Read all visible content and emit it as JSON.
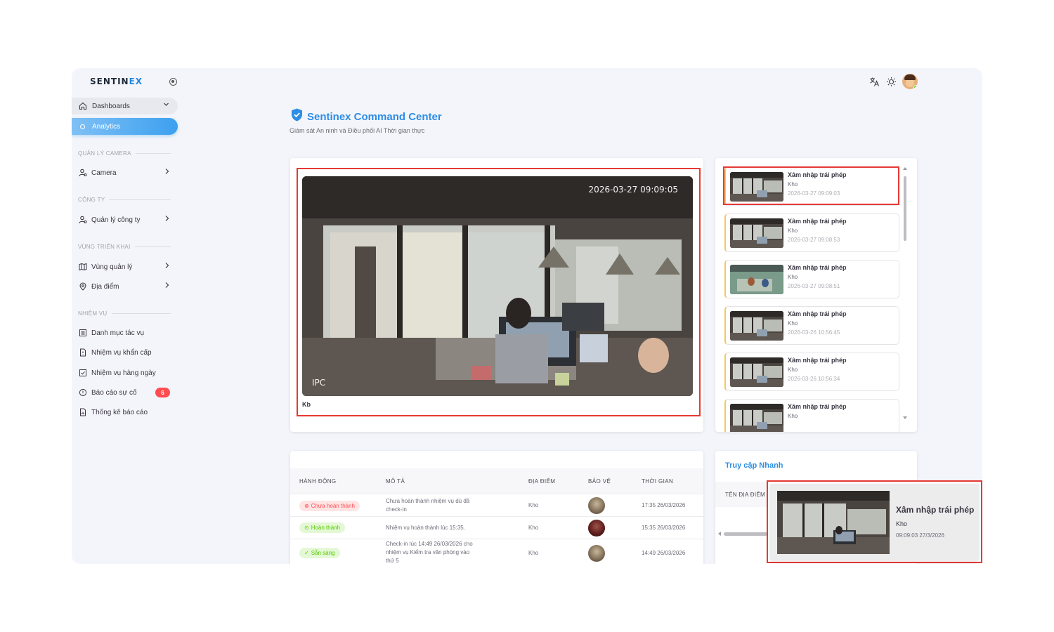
{
  "brand": {
    "name_main": "SENTIN",
    "name_accent": "EX"
  },
  "sidebar": {
    "dashboards_label": "Dashboards",
    "analytics_label": "Analytics",
    "sections": [
      {
        "title": "QUẢN LÝ CAMERA",
        "items": [
          {
            "label": "Camera",
            "icon": "camera-user-icon"
          }
        ]
      },
      {
        "title": "CÔNG TY",
        "items": [
          {
            "label": "Quản lý công ty",
            "icon": "user-settings-icon"
          }
        ]
      },
      {
        "title": "VÙNG TRIỂN KHAI",
        "items": [
          {
            "label": "Vùng quản lý",
            "icon": "map-icon"
          },
          {
            "label": "Địa điểm",
            "icon": "map-pin-icon"
          }
        ]
      },
      {
        "title": "NHIỆM VỤ",
        "items": [
          {
            "label": "Danh mục tác vụ",
            "icon": "list-icon"
          },
          {
            "label": "Nhiệm vụ khẩn cấp",
            "icon": "file-alert-icon"
          },
          {
            "label": "Nhiệm vụ hàng ngày",
            "icon": "checkbox-icon"
          },
          {
            "label": "Báo cáo sự cố",
            "icon": "alert-circle-icon",
            "badge": "6"
          },
          {
            "label": "Thống kê báo cáo",
            "icon": "report-icon"
          }
        ]
      }
    ]
  },
  "header": {
    "title": "Sentinex Command Center",
    "subtitle": "Giám sát An ninh và Điều phối AI Thời gian thực"
  },
  "video": {
    "timestamp": "2026-03-27 09:09:05",
    "overlay_label": "IPC",
    "camera_name": "Kb"
  },
  "alerts": [
    {
      "title": "Xâm nhập trái phép",
      "location": "Kho",
      "time": "2026-03-27 09:09:03"
    },
    {
      "title": "Xâm nhập trái phép",
      "location": "Kho",
      "time": "2026-03-27 09:08:53"
    },
    {
      "title": "Xâm nhập trái phép",
      "location": "Kho",
      "time": "2026-03-27 09:08:51"
    },
    {
      "title": "Xâm nhập trái phép",
      "location": "Kho",
      "time": "2026-03-26 10:56:45"
    },
    {
      "title": "Xâm nhập trái phép",
      "location": "Kho",
      "time": "2026-03-26 10:56:34"
    },
    {
      "title": "Xâm nhập trái phép",
      "location": "Kho",
      "time": ""
    }
  ],
  "table": {
    "headers": [
      "HÀNH ĐỘNG",
      "MÔ TẢ",
      "ĐỊA ĐIỂM",
      "BẢO VỆ",
      "THỜI GIAN"
    ],
    "rows": [
      {
        "status": "Chưa hoàn thành",
        "status_color": "#ff4c51",
        "desc": "Chưa hoàn thành nhiệm vụ dù đã check-in",
        "location": "Kho",
        "time": "17:35 26/03/2026"
      },
      {
        "status": "Hoàn thành",
        "status_color": "#56ca00",
        "desc": "Nhiệm vụ hoàn thành lúc 15:35.",
        "location": "Kho",
        "time": "15:35 26/03/2026"
      },
      {
        "status": "Sẵn sàng",
        "status_color": "#56ca00",
        "desc": "Check-in lúc 14:49 26/03/2026 cho nhiệm vụ Kiểm tra văn phòng vào thứ 5",
        "location": "Kho",
        "time": "14:49 26/03/2026"
      }
    ]
  },
  "quick_access": {
    "title": "Truy cập Nhanh",
    "column_header": "TÊN ĐỊA ĐIỂM"
  },
  "popup": {
    "title": "Xâm nhập trái phép",
    "location": "Kho",
    "time": "09:09:03 27/3/2026"
  },
  "colors": {
    "accent": "#2d8de5",
    "active_nav": "#3da0ef",
    "danger": "#ff4c51",
    "success": "#56ca00",
    "alert_border": "#f4c85a",
    "highlight": "#e53935"
  }
}
